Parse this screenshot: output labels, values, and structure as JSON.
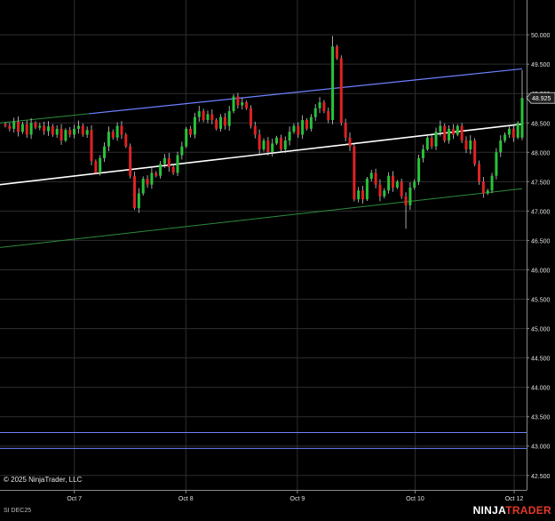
{
  "chart_data": {
    "type": "candlestick",
    "y_ticks": [
      "50.000",
      "49.500",
      "49.000",
      "48.500",
      "48.000",
      "47.500",
      "47.000",
      "46.500",
      "46.000",
      "45.500",
      "45.000",
      "44.500",
      "44.000",
      "43.500",
      "43.000",
      "42.500"
    ],
    "ylim": [
      42.3,
      50.35
    ],
    "x_ticks": [
      {
        "label": "Oct 7",
        "x": 0.1
      },
      {
        "label": "Oct 8",
        "x": 1.0
      },
      {
        "label": "Oct 9",
        "x": 1.9
      },
      {
        "label": "Oct 10",
        "x": 2.85
      },
      {
        "label": "Oct 12",
        "x": 3.65
      }
    ],
    "xlim": [
      -0.5,
      3.75
    ],
    "grid": true,
    "current_price": "48.925",
    "up_color": "#28c23a",
    "down_color": "#e02222",
    "closes": [
      48.45,
      48.4,
      48.52,
      48.35,
      48.48,
      48.3,
      48.5,
      48.42,
      48.45,
      48.36,
      48.44,
      48.3,
      48.4,
      48.2,
      48.38,
      48.3,
      48.4,
      48.45,
      48.3,
      48.38,
      47.85,
      47.65,
      47.9,
      48.1,
      48.35,
      48.25,
      48.45,
      48.3,
      48.1,
      47.6,
      47.05,
      47.3,
      47.55,
      47.45,
      47.65,
      47.6,
      47.8,
      47.9,
      47.75,
      47.65,
      47.95,
      48.1,
      48.4,
      48.3,
      48.6,
      48.7,
      48.55,
      48.65,
      48.55,
      48.4,
      48.6,
      48.45,
      48.7,
      48.95,
      48.8,
      48.85,
      48.75,
      48.45,
      48.3,
      48.05,
      48.2,
      48.0,
      48.15,
      48.25,
      48.05,
      48.2,
      48.35,
      48.45,
      48.3,
      48.55,
      48.4,
      48.6,
      48.75,
      48.85,
      48.7,
      48.55,
      49.8,
      49.6,
      48.5,
      48.25,
      48.1,
      47.2,
      47.35,
      47.2,
      47.55,
      47.65,
      47.45,
      47.25,
      47.35,
      47.6,
      47.4,
      47.5,
      47.25,
      47.1,
      47.4,
      47.5,
      47.9,
      48.05,
      48.25,
      48.1,
      48.35,
      48.45,
      48.2,
      48.4,
      48.3,
      48.45,
      48.2,
      48.05,
      48.2,
      47.8,
      47.5,
      47.3,
      47.35,
      47.6,
      48.0,
      48.2,
      48.3,
      48.4,
      48.25,
      48.5,
      48.925
    ],
    "trendlines": [
      {
        "y_start": 48.5,
        "y_end": 49.42,
        "style": "upper-channel"
      },
      {
        "y_start": 47.45,
        "y_end": 48.48,
        "style": "mid-channel"
      },
      {
        "y_start": 46.38,
        "y_end": 47.38,
        "style": "lower-channel"
      }
    ],
    "support_lines": [
      43.23,
      42.96
    ]
  },
  "overlay": {
    "copyright": "© 2025 NinjaTrader, LLC",
    "instrument": "SI DEC25",
    "logo_main": "NINJA",
    "logo_accent": "TRADER"
  }
}
